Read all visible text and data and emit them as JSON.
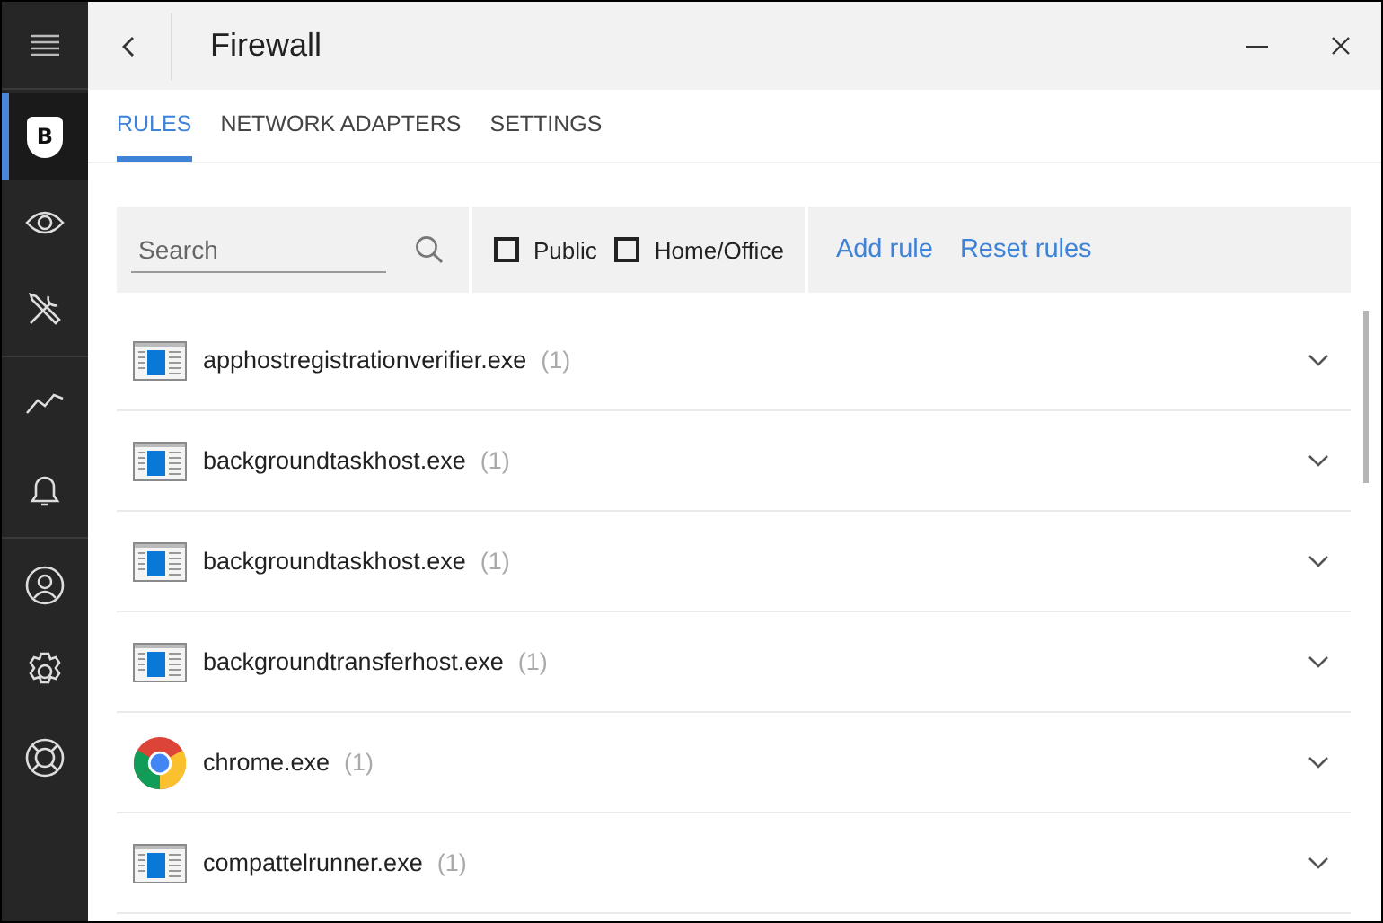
{
  "sidebar": {
    "groups": [
      [
        {
          "kind": "menu",
          "selected": false
        }
      ],
      [
        {
          "kind": "shield",
          "selected": true
        },
        {
          "kind": "eye",
          "selected": false
        },
        {
          "kind": "tools",
          "selected": false
        }
      ],
      [
        {
          "kind": "chart",
          "selected": false
        },
        {
          "kind": "bell",
          "selected": false
        }
      ],
      [
        {
          "kind": "user",
          "selected": false
        },
        {
          "kind": "gear",
          "selected": false
        },
        {
          "kind": "lifebuoy",
          "selected": false
        }
      ]
    ],
    "shield_letter": "B"
  },
  "window": {
    "title": "Firewall"
  },
  "tabs": [
    {
      "label": "RULES",
      "selected": true
    },
    {
      "label": "NETWORK ADAPTERS",
      "selected": false
    },
    {
      "label": "SETTINGS",
      "selected": false
    }
  ],
  "toolbar": {
    "search": {
      "placeholder": "Search"
    },
    "filters": [
      {
        "label": "Public",
        "checked": false
      },
      {
        "label": "Home/Office",
        "checked": false
      }
    ],
    "links": [
      "Add rule",
      "Reset rules"
    ]
  },
  "rules": [
    {
      "kind": "app",
      "name": "apphostregistrationverifier.exe",
      "count": "(1)"
    },
    {
      "kind": "app",
      "name": "backgroundtaskhost.exe",
      "count": "(1)"
    },
    {
      "kind": "app",
      "name": "backgroundtaskhost.exe",
      "count": "(1)"
    },
    {
      "kind": "app",
      "name": "backgroundtransferhost.exe",
      "count": "(1)"
    },
    {
      "kind": "chrome",
      "name": "chrome.exe",
      "count": "(1)"
    },
    {
      "kind": "app",
      "name": "compattelrunner.exe",
      "count": "(1)"
    }
  ]
}
